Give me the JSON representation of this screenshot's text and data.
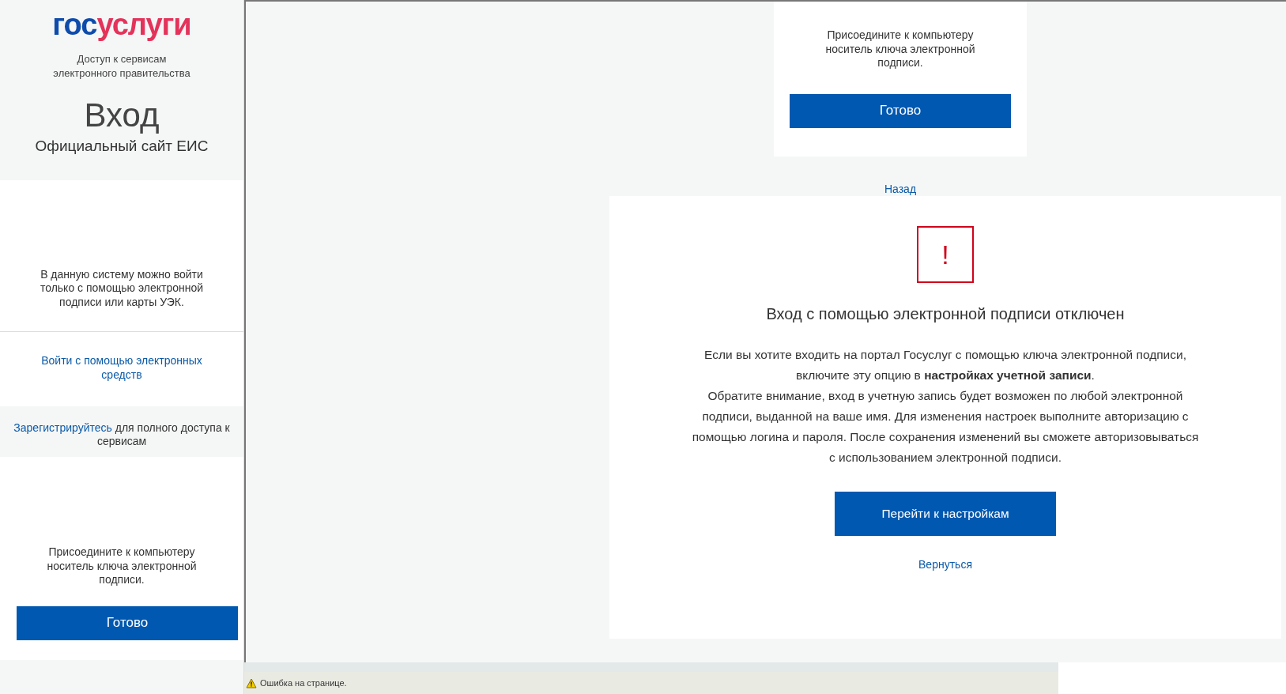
{
  "sidebar": {
    "logo": {
      "first": "гос",
      "second": "услуги"
    },
    "tagline": "Доступ к сервисам электронного правительства",
    "heading": "Вход",
    "subheading": "Официальный сайт ЕИС",
    "notice": "В данную систему можно войти только с помощью электронной подписи или карты УЭК.",
    "esign_link": "Войти с помощью электронных средств",
    "register": {
      "link": "Зарегистрируйтесь",
      "text": "для полного доступа к сервисам"
    },
    "connect_prompt": "Присоедините к компьютеру носитель ключа электронной подписи.",
    "done_button": "Готово"
  },
  "main": {
    "top_card": {
      "prompt": "Присоедините к компьютеру носитель ключа электронной подписи.",
      "button": "Готово"
    },
    "back_link": "Назад",
    "alert": {
      "icon": "!",
      "title": "Вход с помощью электронной подписи отключен",
      "paragraphs": [
        "Если вы хотите входить на портал Госуслуг с помощью ключа электронной подписи, включите эту опцию в **настройках учетной записи**.",
        "Обратите внимание, вход в учетную запись будет возможен по любой электронной подписи, выданной на ваше имя. Для изменения настроек выполните авторизацию с помощью логина и пароля. После сохранения изменений вы сможете авторизовываться с использованием электронной подписи."
      ],
      "button": "Перейти к настройкам",
      "return_link": "Вернуться"
    }
  },
  "status_bar": {
    "text": "Ошибка на странице."
  }
}
